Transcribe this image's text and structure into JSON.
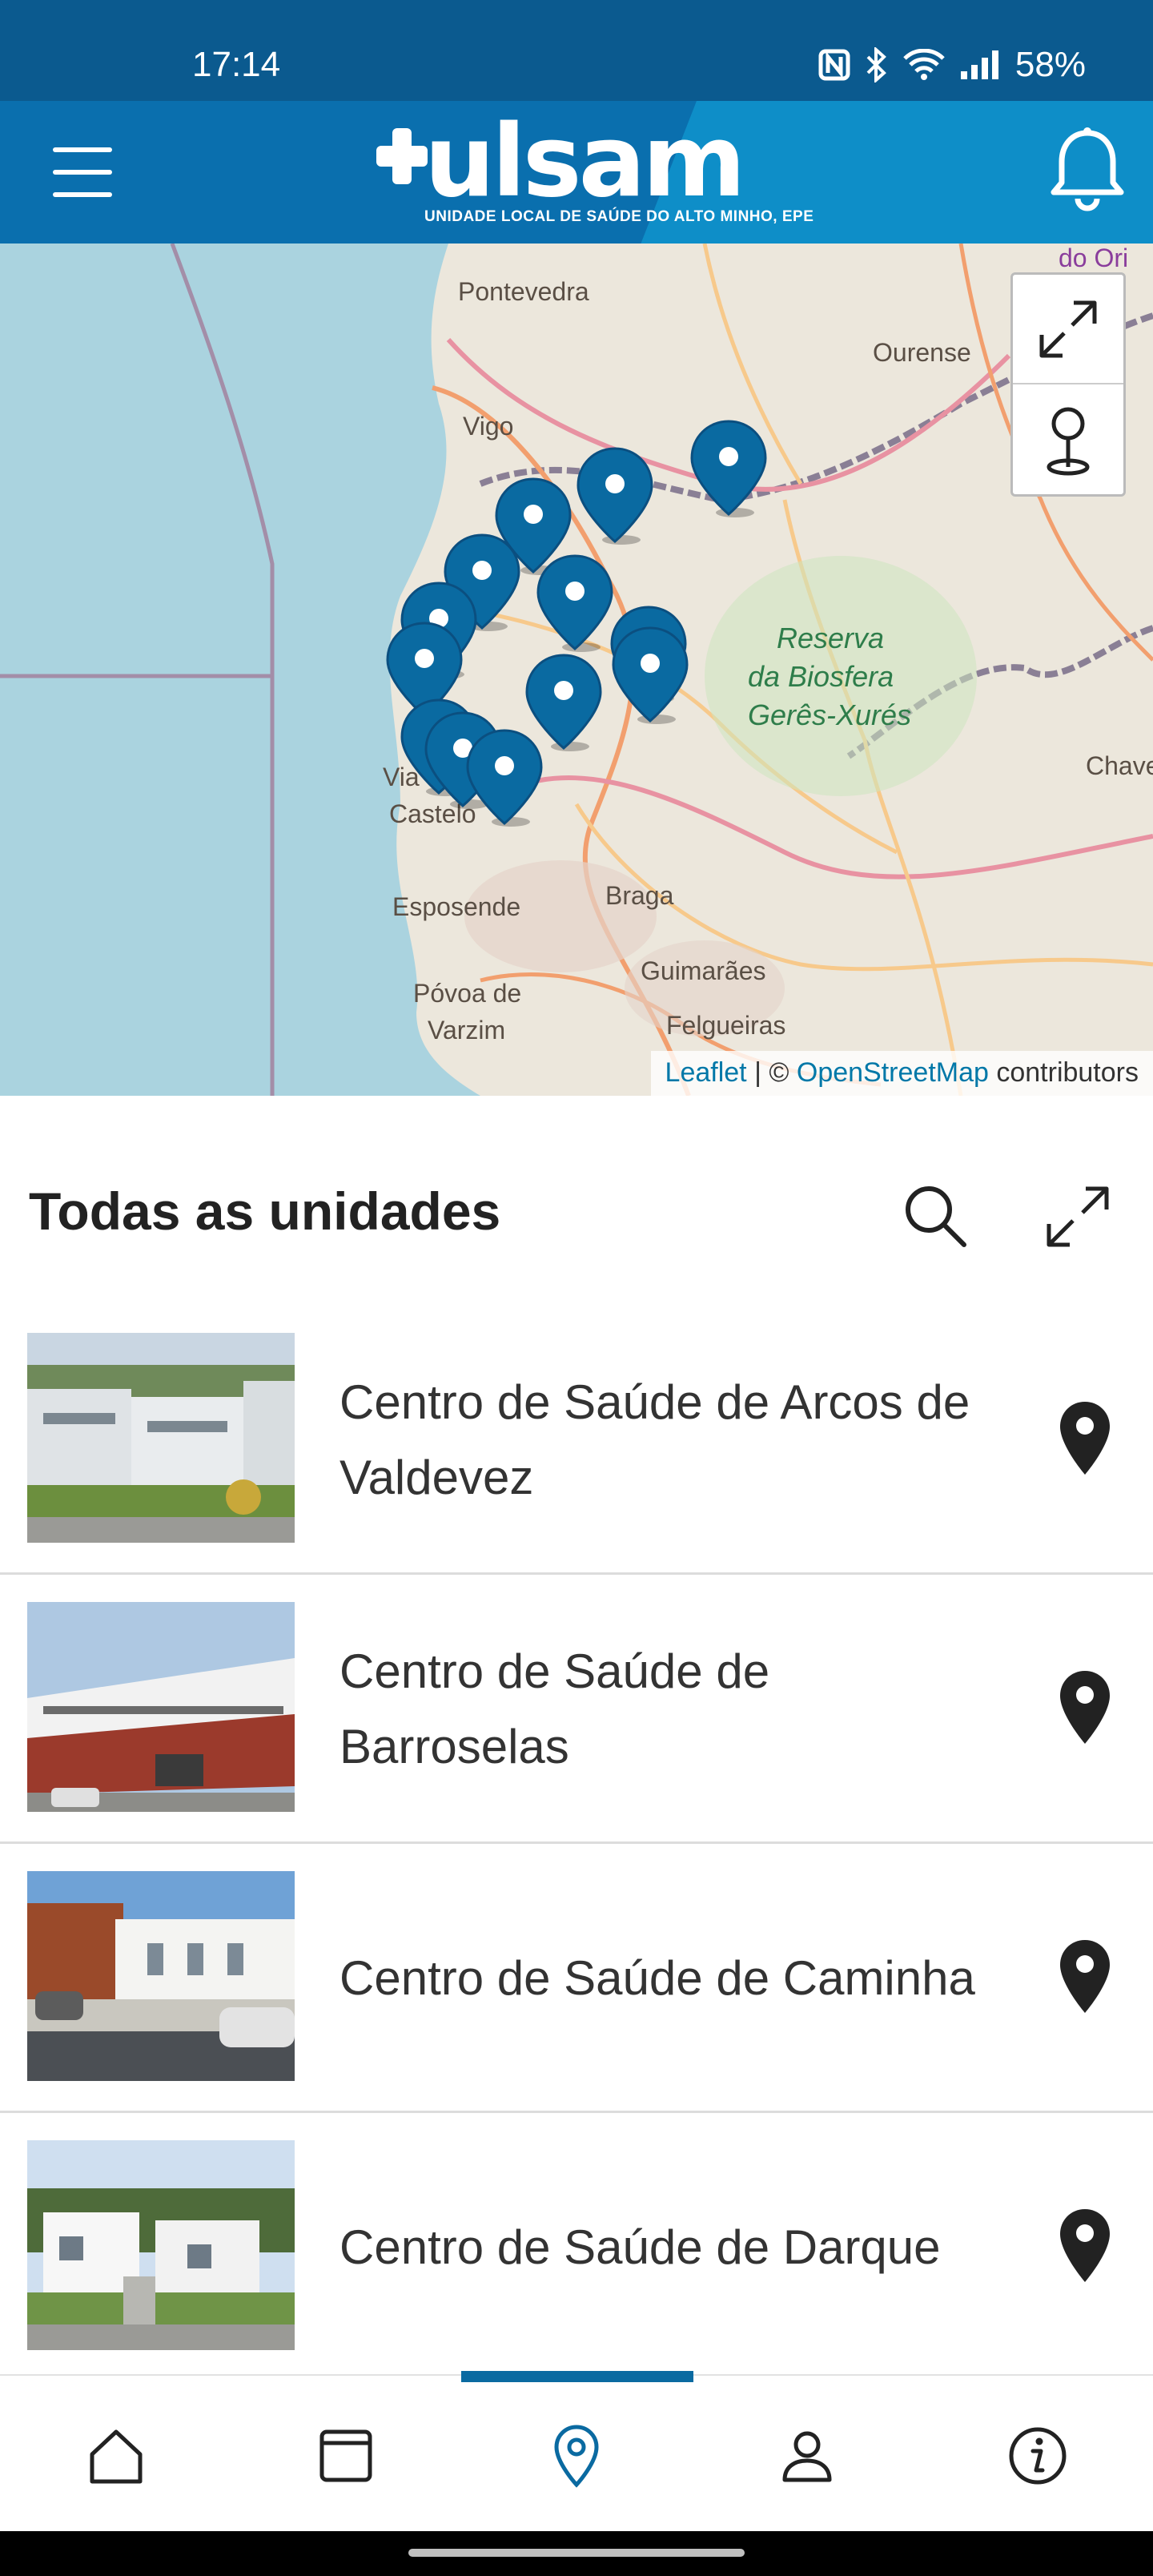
{
  "status_bar": {
    "time": "17:14",
    "battery": "58%"
  },
  "header": {
    "logo_text": "ulsam",
    "logo_subtitle": "UNIDADE LOCAL DE SAÚDE DO ALTO MINHO, EPE",
    "colors": {
      "header_bg": "#0e8ec8",
      "status_bg": "#0b5a8f",
      "marker": "#0a6aa1"
    }
  },
  "map": {
    "labels": [
      "Pontevedra",
      "Ourense",
      "Vigo",
      "Reserva da Biosfera Gerês-Xurés",
      "Viana do Castelo",
      "Esposende",
      "Braga",
      "Póvoa de Varzim",
      "Guimarães",
      "Felgueiras",
      "Chave",
      "do Ori"
    ],
    "place_names": {
      "pontevedra": "Pontevedra",
      "ourense": "Ourense",
      "vigo": "Vigo",
      "reserva_1": "Reserva",
      "reserva_2": "da Biosfera",
      "reserva_3": "Gerês-Xurés",
      "viana_1": "Via",
      "viana_2": "Castelo",
      "esposende": "Esposende",
      "braga": "Braga",
      "povoa_1": "Póvoa de",
      "povoa_2": "Varzim",
      "guimaraes": "Guimarães",
      "felgueiras": "Felgueiras",
      "chaves": "Chave",
      "top_right": "do Ori"
    },
    "attribution": {
      "leaflet": "Leaflet",
      "separator": " | © ",
      "osm": "OpenStreetMap",
      "suffix": " contributors"
    },
    "marker_count": 13
  },
  "section": {
    "title": "Todas as unidades"
  },
  "units": [
    {
      "name": "Centro de Saúde de Arcos de Valdevez"
    },
    {
      "name": "Centro de Saúde de Barroselas"
    },
    {
      "name": "Centro de Saúde de Caminha"
    },
    {
      "name": "Centro de Saúde de Darque"
    }
  ],
  "bottom_nav": {
    "items": [
      "home-icon",
      "calendar-icon",
      "map-pin-icon",
      "user-icon",
      "info-icon"
    ],
    "active_index": 2
  }
}
